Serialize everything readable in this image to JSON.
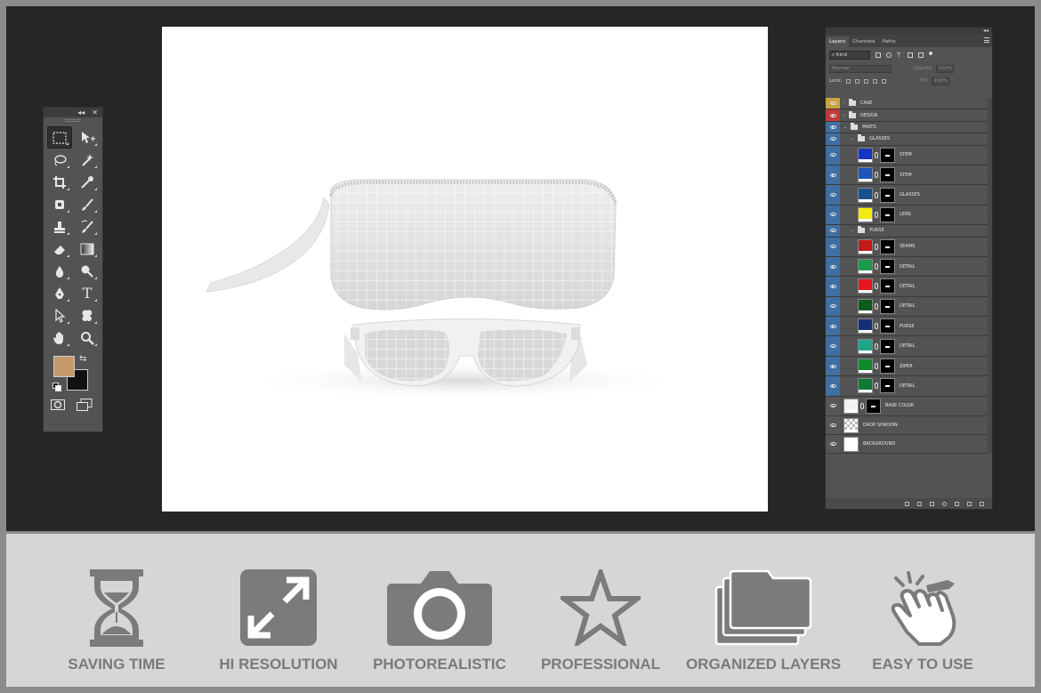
{
  "toolbox": {
    "collapse_glyph": "◂◂",
    "close_glyph": "✕",
    "tools": [
      {
        "name": "marquee-tool-icon",
        "active": true
      },
      {
        "name": "move-tool-icon"
      },
      {
        "name": "lasso-tool-icon"
      },
      {
        "name": "magic-wand-tool-icon"
      },
      {
        "name": "crop-tool-icon"
      },
      {
        "name": "eyedropper-tool-icon"
      },
      {
        "name": "healing-brush-tool-icon"
      },
      {
        "name": "brush-tool-icon"
      },
      {
        "name": "clone-stamp-tool-icon"
      },
      {
        "name": "history-brush-tool-icon"
      },
      {
        "name": "eraser-tool-icon"
      },
      {
        "name": "gradient-tool-icon"
      },
      {
        "name": "blur-tool-icon"
      },
      {
        "name": "dodge-tool-icon"
      },
      {
        "name": "pen-tool-icon"
      },
      {
        "name": "type-tool-icon"
      },
      {
        "name": "path-selection-tool-icon"
      },
      {
        "name": "custom-shape-tool-icon"
      },
      {
        "name": "hand-tool-icon"
      },
      {
        "name": "zoom-tool-icon"
      }
    ],
    "type_glyph": "T",
    "swap_glyph": "⇆",
    "foreground_color": "#c49a6c",
    "background_color": "#111111"
  },
  "layers_panel": {
    "collapse_glyph": "◂◂",
    "tabs": [
      "Layers",
      "Channels",
      "Paths"
    ],
    "active_tab": "Layers",
    "filter_kind": "Kind",
    "blend_mode": "Normal",
    "opacity_label": "Opacity:",
    "opacity_value": "100%",
    "lock_label": "Lock:",
    "fill_label": "Fill:",
    "fill_value": "100%",
    "layers": [
      {
        "name": "CASE",
        "type": "folder",
        "indent": 0,
        "eye_color": "#c8a23c",
        "collapsed": true
      },
      {
        "name": "DESIGN",
        "type": "folder",
        "indent": 0,
        "eye_color": "#c43a3a",
        "collapsed": true
      },
      {
        "name": "PARTS",
        "type": "folder",
        "indent": 0,
        "eye_color": "#3f6fa3",
        "collapsed": false
      },
      {
        "name": "GLASSES",
        "type": "folder",
        "indent": 1,
        "eye_color": "#3f6fa3",
        "collapsed": false
      },
      {
        "name": "STEM",
        "type": "layer",
        "indent": 2,
        "eye_color": "#3f6fa3",
        "swatch": "#1536c0"
      },
      {
        "name": "STEM",
        "type": "layer",
        "indent": 2,
        "eye_color": "#3f6fa3",
        "swatch": "#1d55b8"
      },
      {
        "name": "GLASSES",
        "type": "layer",
        "indent": 2,
        "eye_color": "#3f6fa3",
        "swatch": "#16508e"
      },
      {
        "name": "LENS",
        "type": "layer",
        "indent": 2,
        "eye_color": "#3f6fa3",
        "swatch": "#f3ea10"
      },
      {
        "name": "PURSE",
        "type": "folder",
        "indent": 1,
        "eye_color": "#3f6fa3",
        "collapsed": false
      },
      {
        "name": "SEAMS",
        "type": "layer",
        "indent": 2,
        "eye_color": "#3f6fa3",
        "swatch": "#c41a1a"
      },
      {
        "name": "DETAIL",
        "type": "layer",
        "indent": 2,
        "eye_color": "#3f6fa3",
        "swatch": "#1c9a4e"
      },
      {
        "name": "DETAIL",
        "type": "layer",
        "indent": 2,
        "eye_color": "#3f6fa3",
        "swatch": "#e4161c"
      },
      {
        "name": "DETAIL",
        "type": "layer",
        "indent": 2,
        "eye_color": "#3f6fa3",
        "swatch": "#0c5a1e"
      },
      {
        "name": "PURSE",
        "type": "layer",
        "indent": 2,
        "eye_color": "#3f6fa3",
        "swatch": "#15307a"
      },
      {
        "name": "DETAIL",
        "type": "layer",
        "indent": 2,
        "eye_color": "#3f6fa3",
        "swatch": "#1ea58a"
      },
      {
        "name": "ZIPER",
        "type": "layer",
        "indent": 2,
        "eye_color": "#3f6fa3",
        "swatch": "#0f8a2a"
      },
      {
        "name": "DETAIL",
        "type": "layer",
        "indent": 2,
        "eye_color": "#3f6fa3",
        "swatch": "#107a34"
      },
      {
        "name": "BASE COLOR",
        "type": "layer",
        "indent": 0,
        "eye_color": "#575757",
        "swatch": "#f4f4f4"
      },
      {
        "name": "DROP SHADOW",
        "type": "plain",
        "indent": 0,
        "eye_color": "#575757",
        "swatch": "checker"
      },
      {
        "name": "BACKGROUND",
        "type": "plain",
        "indent": 0,
        "eye_color": "#575757",
        "swatch": "#ffffff"
      }
    ]
  },
  "features": [
    {
      "label": "SAVING TIME",
      "icon": "hourglass-icon"
    },
    {
      "label": "HI RESOLUTION",
      "icon": "expand-arrows-icon"
    },
    {
      "label": "PHOTOREALISTIC",
      "icon": "camera-icon"
    },
    {
      "label": "PROFESSIONAL",
      "icon": "star-icon"
    },
    {
      "label": "ORGANIZED LAYERS",
      "icon": "folders-icon"
    },
    {
      "label": "EASY TO USE",
      "icon": "tap-hand-icon"
    }
  ]
}
